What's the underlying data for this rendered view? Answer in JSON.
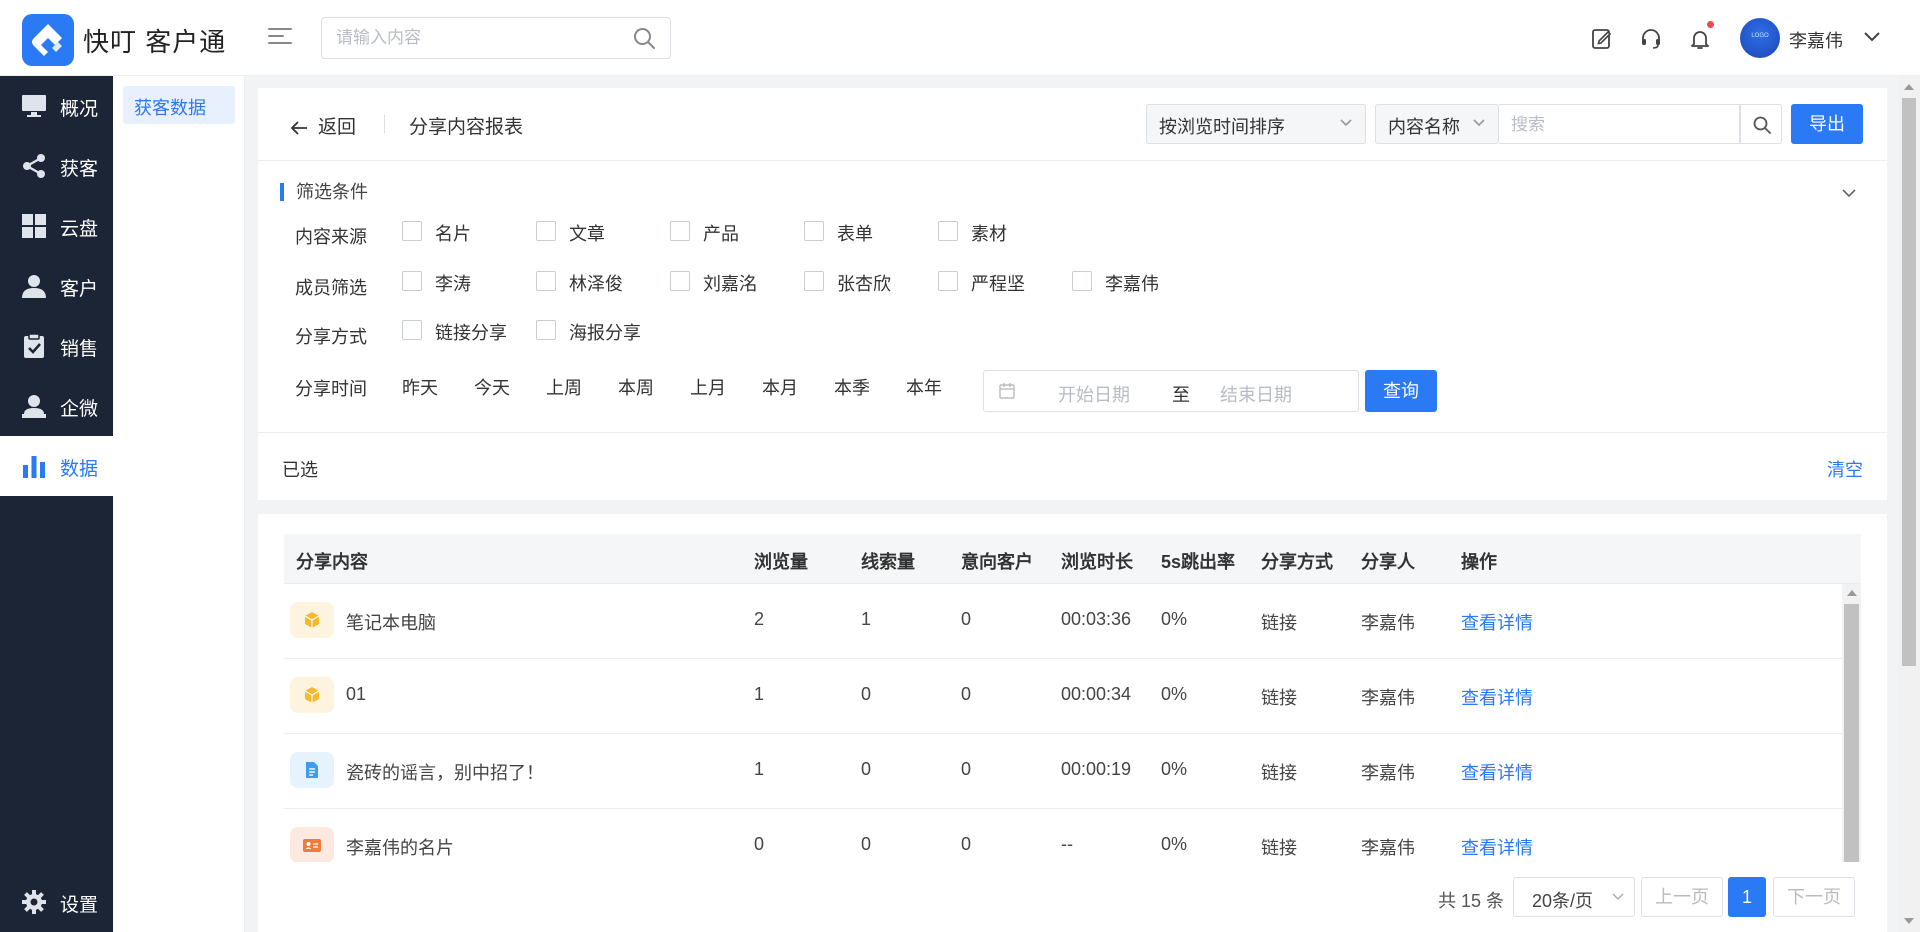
{
  "app": {
    "brand": "快叮 客户通",
    "search_placeholder": "请输入内容",
    "user_name": "李嘉伟",
    "avatar_text": "LOGO"
  },
  "nav": [
    {
      "label": "概况",
      "icon": "monitor-icon"
    },
    {
      "label": "获客",
      "icon": "share-icon"
    },
    {
      "label": "云盘",
      "icon": "grid-icon"
    },
    {
      "label": "客户",
      "icon": "user-icon"
    },
    {
      "label": "销售",
      "icon": "clipboard-check-icon"
    },
    {
      "label": "企微",
      "icon": "person-badge-icon"
    },
    {
      "label": "数据",
      "icon": "bar-chart-icon",
      "active": true
    },
    {
      "label": "设置",
      "icon": "gear-icon"
    }
  ],
  "subnav": {
    "active_item": "获客数据"
  },
  "topbar": {
    "back_label": "返回",
    "title": "分享内容报表",
    "sort_select": "按浏览时间排序",
    "field_select": "内容名称",
    "search_placeholder": "搜索",
    "export_label": "导出"
  },
  "filters": {
    "heading": "筛选条件",
    "content_source": {
      "label": "内容来源",
      "options": [
        "名片",
        "文章",
        "产品",
        "表单",
        "素材"
      ]
    },
    "member": {
      "label": "成员筛选",
      "options": [
        "李涛",
        "林泽俊",
        "刘嘉洺",
        "张杏欣",
        "严程坚",
        "李嘉伟"
      ]
    },
    "share_method": {
      "label": "分享方式",
      "options": [
        "链接分享",
        "海报分享"
      ]
    },
    "share_time": {
      "label": "分享时间",
      "options": [
        "昨天",
        "今天",
        "上周",
        "本周",
        "上月",
        "本月",
        "本季",
        "本年"
      ],
      "start_placeholder": "开始日期",
      "to": "至",
      "end_placeholder": "结束日期"
    },
    "query_label": "查询"
  },
  "selected": {
    "label": "已选",
    "clear_label": "清空"
  },
  "table": {
    "columns": [
      "分享内容",
      "浏览量",
      "线索量",
      "意向客户",
      "浏览时长",
      "5s跳出率",
      "分享方式",
      "分享人",
      "操作"
    ],
    "rows": [
      {
        "icon": "product-box-icon",
        "name": "笔记本电脑",
        "views": "2",
        "leads": "1",
        "intent": "0",
        "duration": "00:03:36",
        "bounce": "0%",
        "method": "链接",
        "sharer": "李嘉伟",
        "action": "查看详情"
      },
      {
        "icon": "product-box-icon",
        "name": "01",
        "views": "1",
        "leads": "0",
        "intent": "0",
        "duration": "00:00:34",
        "bounce": "0%",
        "method": "链接",
        "sharer": "李嘉伟",
        "action": "查看详情"
      },
      {
        "icon": "article-doc-icon",
        "name": "瓷砖的谣言，别中招了！",
        "views": "1",
        "leads": "0",
        "intent": "0",
        "duration": "00:00:19",
        "bounce": "0%",
        "method": "链接",
        "sharer": "李嘉伟",
        "action": "查看详情"
      },
      {
        "icon": "business-card-icon",
        "name": "李嘉伟的名片",
        "views": "0",
        "leads": "0",
        "intent": "0",
        "duration": "--",
        "bounce": "0%",
        "method": "链接",
        "sharer": "李嘉伟",
        "action": "查看详情"
      }
    ]
  },
  "pagination": {
    "total": "共 15 条",
    "page_size": "20条/页",
    "prev": "上一页",
    "current": "1",
    "next": "下一页"
  },
  "colors": {
    "primary": "#2a79f5",
    "nav_bg": "#1c2536",
    "notification_dot": "#f04848"
  }
}
